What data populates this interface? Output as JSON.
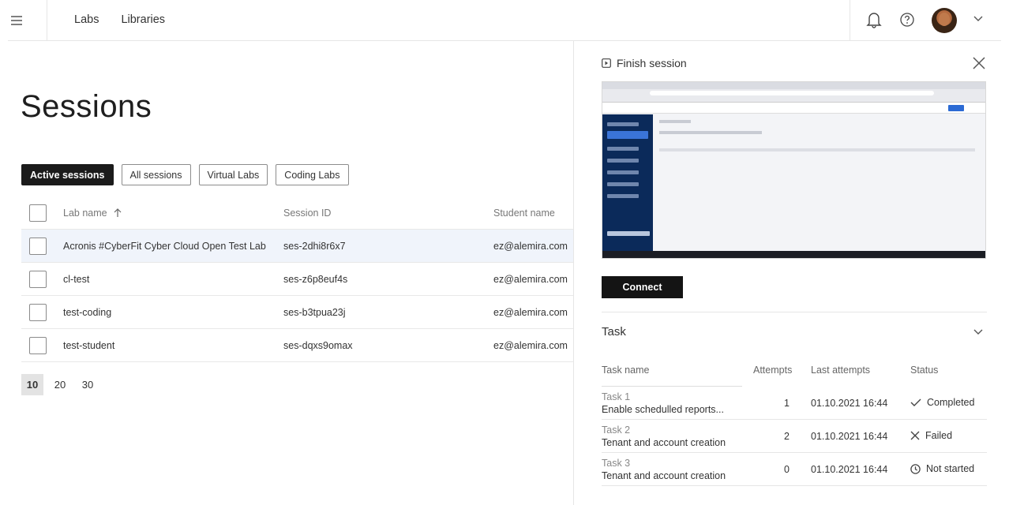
{
  "header": {
    "nav": [
      "Labs",
      "Libraries"
    ]
  },
  "page": {
    "title": "Sessions",
    "filters": [
      {
        "label": "Active sessions",
        "active": true
      },
      {
        "label": "All sessions",
        "active": false
      },
      {
        "label": "Virtual Labs",
        "active": false
      },
      {
        "label": "Coding Labs",
        "active": false
      }
    ]
  },
  "sessions": {
    "columns": {
      "lab_name": "Lab name",
      "session_id": "Session ID",
      "student_name": "Student name"
    },
    "rows": [
      {
        "lab": "Acronis #CyberFit Cyber Cloud Open Test Lab",
        "sid": "ses-2dhi8r6x7",
        "student": "ez@alemira.com",
        "selected": true
      },
      {
        "lab": "cl-test",
        "sid": "ses-z6p8euf4s",
        "student": "ez@alemira.com",
        "selected": false
      },
      {
        "lab": "test-coding",
        "sid": "ses-b3tpua23j",
        "student": "ez@alemira.com",
        "selected": false
      },
      {
        "lab": "test-student",
        "sid": "ses-dqxs9omax",
        "student": "ez@alemira.com",
        "selected": false
      }
    ]
  },
  "pager": {
    "sizes": [
      "10",
      "20",
      "30"
    ],
    "active": "10"
  },
  "panel": {
    "finish_label": "Finish session",
    "connect_label": "Connect",
    "task_title": "Task",
    "task_columns": {
      "name": "Task name",
      "attempts": "Attempts",
      "last": "Last attempts",
      "status": "Status"
    },
    "tasks": [
      {
        "name": "Task 1",
        "desc": "Enable schedulled reports...",
        "attempts": "1",
        "last": "01.10.2021 16:44",
        "status": "Completed",
        "status_icon": "check-icon"
      },
      {
        "name": "Task 2",
        "desc": "Tenant and account creation",
        "attempts": "2",
        "last": "01.10.2021 16:44",
        "status": "Failed",
        "status_icon": "x-icon"
      },
      {
        "name": "Task 3",
        "desc": "Tenant and account creation",
        "attempts": "0",
        "last": "01.10.2021 16:44",
        "status": "Not started",
        "status_icon": "clock-icon"
      }
    ]
  }
}
